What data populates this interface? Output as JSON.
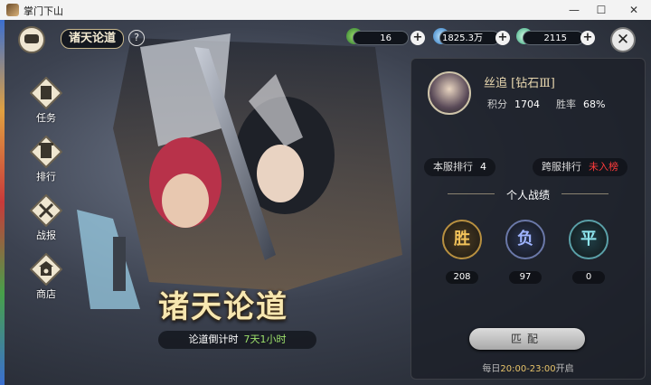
{
  "window": {
    "title": "掌门下山",
    "minimize": "—",
    "maximize": "☐",
    "close": "✕"
  },
  "header": {
    "page_title": "诸天论道",
    "help": "?",
    "close": "✕"
  },
  "resources": [
    {
      "icon": "jade-icon",
      "value": "16",
      "color": "#3fae3f"
    },
    {
      "icon": "crystal-icon",
      "value": "1825.3万",
      "color": "#4aa8e8"
    },
    {
      "icon": "feather-icon",
      "value": "2115",
      "color": "#6fd0b0"
    }
  ],
  "plus": "+",
  "nav": [
    {
      "label": "任务",
      "icon": "scroll-icon"
    },
    {
      "label": "排行",
      "icon": "banner-icon"
    },
    {
      "label": "战报",
      "icon": "battle-report-icon"
    },
    {
      "label": "商店",
      "icon": "shop-icon"
    }
  ],
  "banner": {
    "title": "诸天论道",
    "countdown_label": "论道倒计时",
    "countdown_value": "7天1小时"
  },
  "profile": {
    "name": "丝追 [钻石Ⅲ]",
    "score_label": "积分",
    "score": "1704",
    "winrate_label": "胜率",
    "winrate": "68%",
    "server_rank_label": "本服排行",
    "server_rank": "4",
    "cross_rank_label": "跨服排行",
    "cross_rank": "未入榜"
  },
  "record": {
    "title": "个人战绩",
    "win_label": "胜",
    "win": "208",
    "loss_label": "负",
    "loss": "97",
    "draw_label": "平",
    "draw": "0"
  },
  "match_button": "匹配",
  "schedule": {
    "prefix": "每日",
    "time": "20:00-23:00",
    "suffix": "开启"
  }
}
